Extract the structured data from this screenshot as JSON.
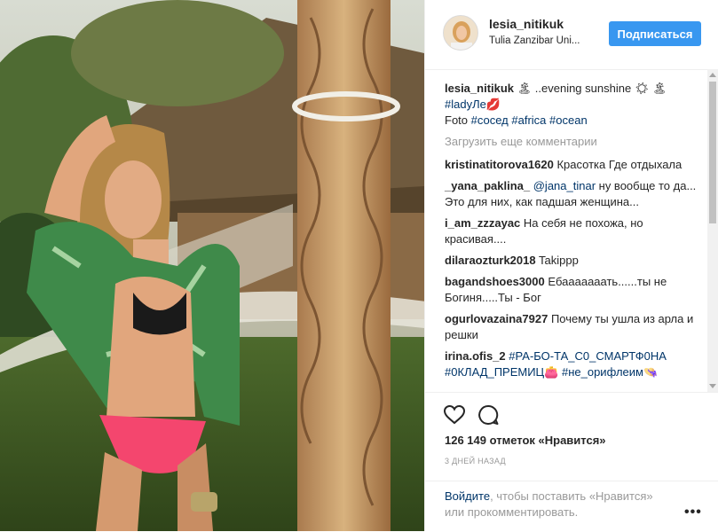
{
  "header": {
    "username": "lesia_nitikuk",
    "location": "Tulia Zanzibar Uni...",
    "follow_label": "Подписаться"
  },
  "caption": {
    "username": "lesia_nitikuk",
    "text": " 🏝 ..evening sunshine ☀ 🏝",
    "tag1": "#ladyЛе💋",
    "line3_prefix": "Foto ",
    "tag2": "#сосед",
    "tag3": "#africa",
    "tag4": "#ocean"
  },
  "load_more": "Загрузить еще комментарии",
  "comments": [
    {
      "user": "kristinatitorova1620",
      "text": " Красотка Где отдыхала"
    },
    {
      "user": "_yana_paklina_",
      "mention": " @jana_tinar",
      "text": " ну вообще то да... Это для них, как падшая женщина..."
    },
    {
      "user": "i_am_zzzayac",
      "text": " На себя не похожа, но красивая...."
    },
    {
      "user": "dilaraozturk2018",
      "text": " Takippp"
    },
    {
      "user": "bagandshoes3000",
      "text": " Ебааааааать......ты не Богиня.....Ты - Бог"
    },
    {
      "user": "ogurlovazaina7927",
      "text": " Почему ты ушла из арла и решки"
    },
    {
      "user": "irina.ofis_2",
      "tag": " #РА-БО-ТА_С0_СМАРТФ0НА #0КЛАД_ПРЕМИЦ👛 #не_орифлеим👒"
    }
  ],
  "actions": {
    "likes": "126 149 отметок «Нравится»",
    "time": "3 ДНЕЙ НАЗАД"
  },
  "login_prompt": {
    "link": "Войдите",
    "rest": ", чтобы поставить «Нравится» или прокомментировать.",
    "more": "•••"
  },
  "colors": {
    "follow_button": "#3897f0",
    "link": "#003569",
    "muted": "#999999",
    "border": "#efefef"
  }
}
